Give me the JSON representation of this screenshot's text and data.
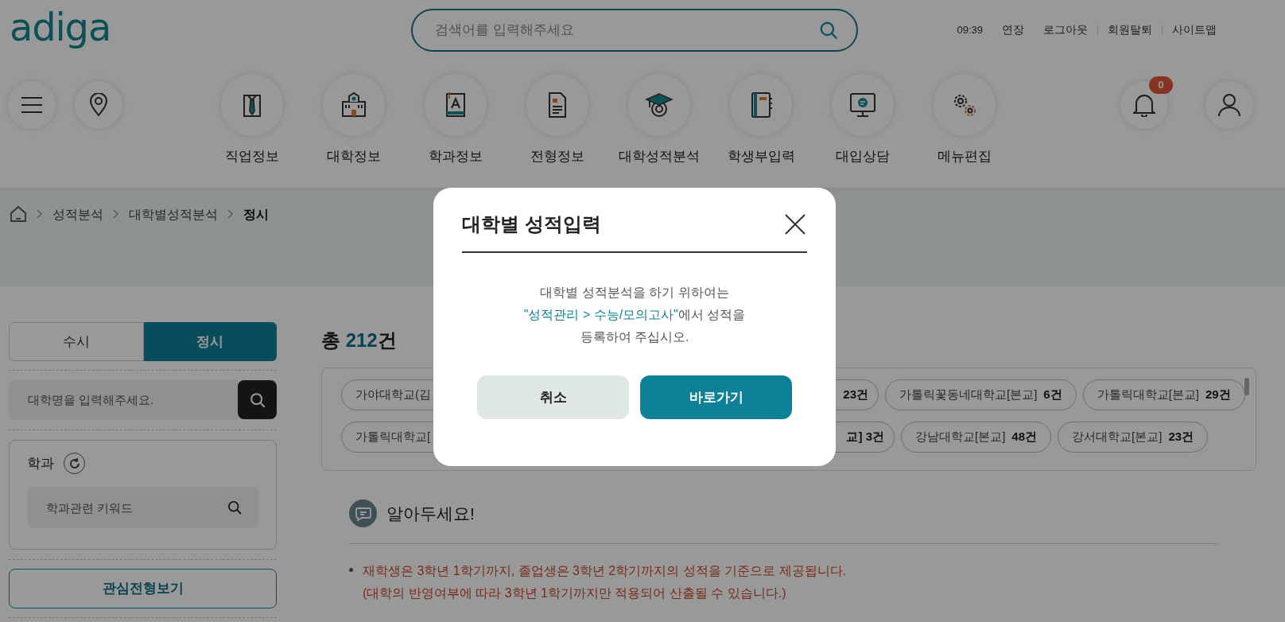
{
  "header": {
    "logo": "adiga",
    "search": {
      "placeholder": "검색어를 입력해주세요"
    },
    "time": "09:39",
    "links": [
      "연장",
      "로그아웃",
      "회원탈퇴",
      "사이트맵"
    ]
  },
  "nav": [
    {
      "label": "직업정보"
    },
    {
      "label": "대학정보"
    },
    {
      "label": "학과정보"
    },
    {
      "label": "전형정보"
    },
    {
      "label": "대학성적분석"
    },
    {
      "label": "학생부입력"
    },
    {
      "label": "대입상담"
    },
    {
      "label": "메뉴편집"
    }
  ],
  "notifications": {
    "count": "0"
  },
  "breadcrumb": [
    "성적분석",
    "대학별성적분석",
    "정시"
  ],
  "sidebar": {
    "tabs": [
      {
        "label": "수시",
        "selected": false
      },
      {
        "label": "정시",
        "selected": true
      }
    ],
    "university_search": {
      "placeholder": "대학명을 입력해주세요."
    },
    "department": {
      "title": "학과",
      "search": {
        "placeholder": "학과관련 키워드"
      }
    },
    "interest_button": "관심전형보기"
  },
  "results": {
    "total_prefix": "총 ",
    "total_count": "212",
    "total_suffix": "건",
    "chip_rows": [
      {
        "left": "가야대학교(김",
        "right": "23건",
        "chips": [
          {
            "name": "가톨릭꽃동네대학교[본교]",
            "count": "6건"
          },
          {
            "name": "가톨릭대학교[본교]",
            "count": "29건"
          }
        ]
      },
      {
        "left": "가톨릭대학교[",
        "right": "교] 3건",
        "chips": [
          {
            "name": "강남대학교[본교]",
            "count": "48건"
          },
          {
            "name": "강서대학교[본교]",
            "count": "23건"
          }
        ]
      }
    ]
  },
  "notice": {
    "title": "알아두세요!",
    "lines": [
      "재학생은 3학년 1학기까지, 졸업생은 3학년 2학기까지의 성적을 기준으로 제공됩니다.",
      "(대학의 반영여부에 따라 3학년 1학기까지만 적용되어 산출될 수 있습니다.)"
    ]
  },
  "modal": {
    "title": "대학별 성적입력",
    "message": [
      [
        {
          "text": "대학별 성적분석을 하기 위하여는",
          "highlight": false
        }
      ],
      [
        {
          "text": "\"성적관리 > 수능/모의고사\"",
          "highlight": true
        },
        {
          "text": "에서 성적을",
          "highlight": false
        }
      ],
      [
        {
          "text": "등록하여 주십시오.",
          "highlight": false
        }
      ]
    ],
    "buttons": [
      {
        "label": "취소",
        "kind": "secondary"
      },
      {
        "label": "바로가기",
        "kind": "primary"
      }
    ]
  }
}
